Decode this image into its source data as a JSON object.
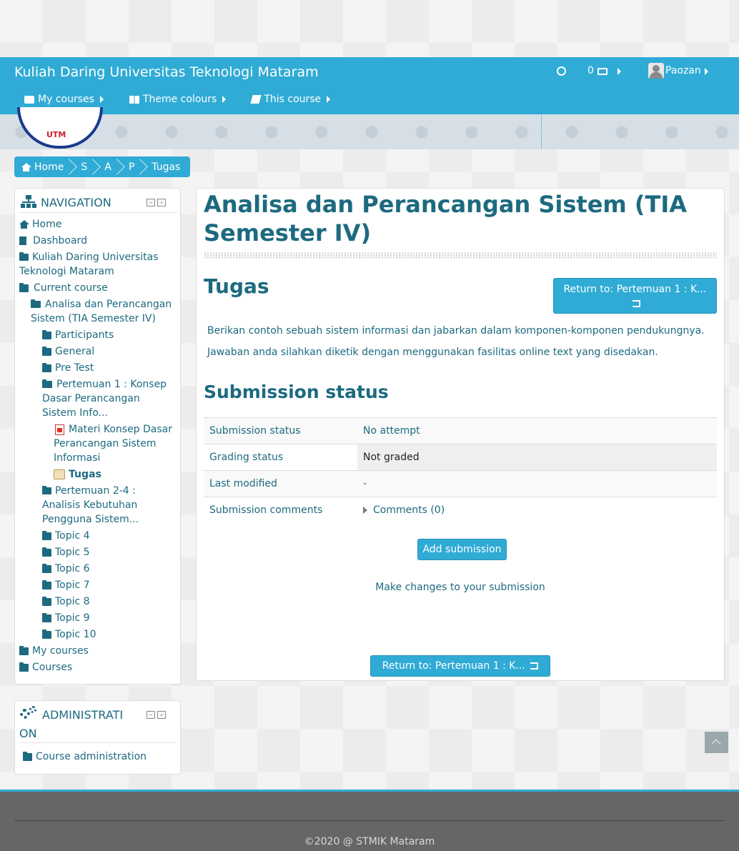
{
  "header": {
    "site_title": "Kuliah Daring Universitas Teknologi Mataram",
    "messages_count": "0",
    "user_name": "Paozan",
    "menu": [
      {
        "label": "My courses",
        "icon": "briefcase-icon"
      },
      {
        "label": "Theme colours",
        "icon": "grid-icon"
      },
      {
        "label": "This course",
        "icon": "book-icon"
      }
    ],
    "logo_text": "UTM"
  },
  "breadcrumb": [
    "Home",
    "S",
    "A",
    "P",
    "Tugas"
  ],
  "navigation": {
    "title": "NAVIGATION",
    "items": {
      "home": "Home",
      "dashboard": "Dashboard",
      "site": "Kuliah Daring Universitas Teknologi Mataram",
      "current_course": "Current course",
      "course": "Analisa dan Perancangan Sistem (TIA Semester IV)",
      "participants": "Participants",
      "general": "General",
      "pretest": "Pre Test",
      "pertemuan1": "Pertemuan 1 : Konsep Dasar Perancangan Sistem Info...",
      "materi": "Materi Konsep Dasar Perancangan Sistem Informasi",
      "tugas": "Tugas",
      "pertemuan2": "Pertemuan 2-4 : Analisis Kebutuhan Pengguna Sistem...",
      "topic4": "Topic 4",
      "topic5": "Topic 5",
      "topic6": "Topic 6",
      "topic7": "Topic 7",
      "topic8": "Topic 8",
      "topic9": "Topic 9",
      "topic10": "Topic 10",
      "mycourses": "My courses",
      "courses": "Courses"
    }
  },
  "administration": {
    "title_line1": "ADMINISTRATI",
    "title_line2": "ON",
    "course_admin": "Course administration"
  },
  "main": {
    "course_title": "Analisa dan Perancangan Sistem (TIA Semester IV)",
    "activity_title": "Tugas",
    "return_button_top": "Return to: Pertemuan 1 : K...",
    "intro1": "Berikan contoh sebuah sistem informasi dan jabarkan dalam komponen-komponen pendukungnya.",
    "intro2": "Jawaban anda silahkan diketik dengan menggunakan fasilitas online text yang disedakan.",
    "submission_heading": "Submission status",
    "table": [
      {
        "label": "Submission status",
        "value": "No attempt"
      },
      {
        "label": "Grading status",
        "value": "Not graded"
      },
      {
        "label": "Last modified",
        "value": "-"
      },
      {
        "label": "Submission comments",
        "value": "Comments (0)"
      }
    ],
    "add_submission": "Add submission",
    "make_changes": "Make changes to your submission",
    "return_button_bottom": "Return to: Pertemuan 1 : K..."
  },
  "footer": {
    "text": "©2020 @ STMIK Mataram"
  }
}
